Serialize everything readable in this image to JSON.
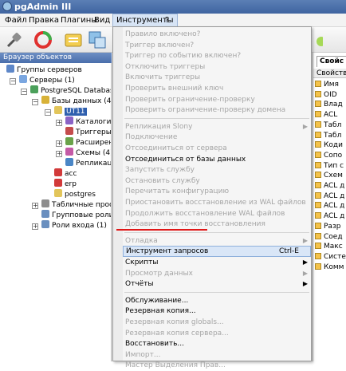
{
  "app_title": "pgAdmin III",
  "menubar": [
    "Файл",
    "Правка",
    "Плагины",
    "Вид",
    "Инструменты",
    "?"
  ],
  "browser_title": "Браузер объектов",
  "tree": [
    {
      "label": "Группы серверов",
      "color": "#5e87c8"
    },
    {
      "label": "Серверы (1)",
      "color": "#7aa6e0"
    },
    {
      "label": "PostgreSQL Database S",
      "color": "#4ba05b"
    },
    {
      "label": "Базы данных (4)",
      "color": "#d8b238"
    },
    {
      "label": "UT11",
      "color": "#e2c55a"
    },
    {
      "label": "Каталоги (",
      "color": "#8a63c6"
    },
    {
      "label": "Триггеры п",
      "color": "#c44c4c"
    },
    {
      "label": "Расширени",
      "color": "#6aa24a"
    },
    {
      "label": "Схемы (4)",
      "color": "#c45aa6"
    },
    {
      "label": "Репликаци",
      "color": "#4a86c6"
    },
    {
      "label": "acc",
      "color": "#d23a3a"
    },
    {
      "label": "erp",
      "color": "#d23a3a"
    },
    {
      "label": "postgres",
      "color": "#e2c55a"
    },
    {
      "label": "Табличные простр",
      "color": "#8d8d8d"
    },
    {
      "label": "Групповые роли (0",
      "color": "#6a8fbf"
    },
    {
      "label": "Роли входа (1)",
      "color": "#6a8fbf"
    }
  ],
  "right_tab": "Свойс",
  "right_header": "Свойств",
  "properties": [
    "Имя",
    "OID",
    "Влад",
    "ACL",
    "Табл",
    "Табл",
    "Коди",
    "Сопо",
    "Тип с",
    "Схем",
    "ACL д",
    "ACL д",
    "ACL д",
    "ACL д",
    "Разр",
    "Соед",
    "Макс",
    "Систе",
    "Комм"
  ],
  "menu": [
    {
      "label": "Правило включено?",
      "disabled": true
    },
    {
      "label": "Триггер включен?",
      "disabled": true
    },
    {
      "label": "Триггер по событию включен?",
      "disabled": true
    },
    {
      "label": "Отключить триггеры",
      "disabled": true
    },
    {
      "label": "Включить триггеры",
      "disabled": true
    },
    {
      "label": "Проверить внешний ключ",
      "disabled": true
    },
    {
      "label": "Проверить ограничение-проверку",
      "disabled": true
    },
    {
      "label": "Проверить ограничение-проверку домена",
      "disabled": true
    },
    {
      "sep": true
    },
    {
      "label": "Репликация Slony",
      "disabled": true,
      "submenu": true
    },
    {
      "label": "Подключение",
      "disabled": true
    },
    {
      "label": "Отсоединиться от сервера",
      "disabled": true
    },
    {
      "label": "Отсоединиться от базы данных",
      "disabled": false
    },
    {
      "label": "Запустить службу",
      "disabled": true
    },
    {
      "label": "Остановить службу",
      "disabled": true
    },
    {
      "label": "Перечитать конфигурацию",
      "disabled": true
    },
    {
      "label": "Приостановить восстановление из WAL файлов",
      "disabled": true
    },
    {
      "label": "Продолжить восстановление WAL файлов",
      "disabled": true
    },
    {
      "label": "Добавить имя точки восстановления",
      "disabled": true
    },
    {
      "sep": true
    },
    {
      "label": "Отладка",
      "disabled": true,
      "submenu": true
    },
    {
      "label": "Инструмент запросов",
      "disabled": false,
      "shortcut": "Ctrl-E",
      "highlight": true
    },
    {
      "label": "Скрипты",
      "disabled": false,
      "submenu": true
    },
    {
      "label": "Просмотр данных",
      "disabled": true,
      "submenu": true
    },
    {
      "label": "Отчёты",
      "disabled": false,
      "submenu": true
    },
    {
      "sep": true
    },
    {
      "label": "Обслуживание...",
      "disabled": false
    },
    {
      "label": "Резервная копия...",
      "disabled": false
    },
    {
      "label": "Резервная копия globals...",
      "disabled": true
    },
    {
      "label": "Резервная копия сервера...",
      "disabled": true
    },
    {
      "label": "Восстановить...",
      "disabled": false
    },
    {
      "label": "Импорт...",
      "disabled": true
    },
    {
      "label": "Мастер Выделения Прав...",
      "disabled": true
    }
  ],
  "colors": {
    "title_bar": "#4a70aa",
    "highlight": "#d9e6f7",
    "underline": "#e01818"
  }
}
